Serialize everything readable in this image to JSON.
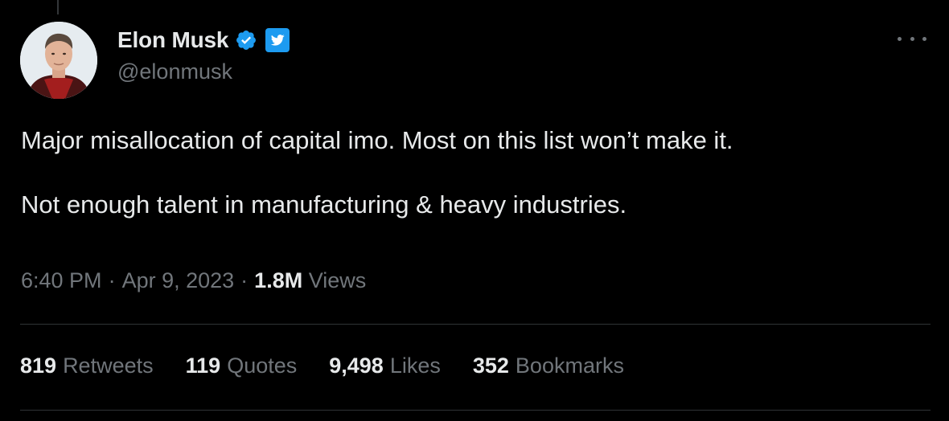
{
  "tweet": {
    "author": {
      "name": "Elon Musk",
      "handle": "@elonmusk",
      "verified_icon": "verified-badge-icon",
      "platform_icon": "twitter-bird-icon"
    },
    "text": [
      "Major misallocation of capital imo. Most on this list won’t make it.",
      "Not enough talent in manufacturing & heavy industries."
    ],
    "time": "6:40 PM",
    "separator": "·",
    "date": "Apr 9, 2023",
    "views_count": "1.8M",
    "views_label": "Views"
  },
  "stats": [
    {
      "count": "819",
      "label": "Retweets"
    },
    {
      "count": "119",
      "label": "Quotes"
    },
    {
      "count": "9,498",
      "label": "Likes"
    },
    {
      "count": "352",
      "label": "Bookmarks"
    }
  ],
  "colors": {
    "background": "#000000",
    "primary_text": "#e7e9ea",
    "secondary_text": "#71767b",
    "accent": "#1d9bf0",
    "divider": "#2f3336"
  }
}
